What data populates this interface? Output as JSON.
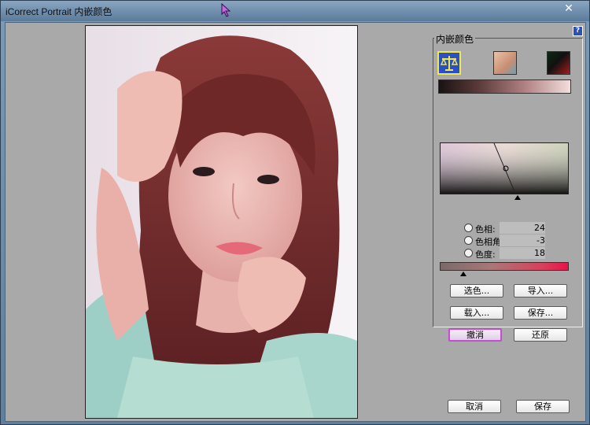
{
  "window": {
    "title": "iCorrect Portrait 内嵌颜色",
    "close_glyph": "✕",
    "help_glyph": "?"
  },
  "panel": {
    "legend": "内嵌颜色",
    "mode_icons": [
      "balance-icon",
      "face-icon",
      "gradient-icon"
    ]
  },
  "color_values": [
    {
      "label": "色相:",
      "value": "24"
    },
    {
      "label": "色相角:",
      "value": "-3"
    },
    {
      "label": "色度:",
      "value": "18"
    }
  ],
  "buttons": {
    "pick_color": "选色...",
    "import": "导入...",
    "load": "载入...",
    "save_preset": "保存...",
    "undo": "撤消",
    "restore": "还原",
    "cancel": "取消",
    "save": "保存"
  },
  "colors": {
    "accent_focus": "#c84bd8",
    "client_bg": "#a9a9a9",
    "title_bar": "#6d8cab"
  }
}
